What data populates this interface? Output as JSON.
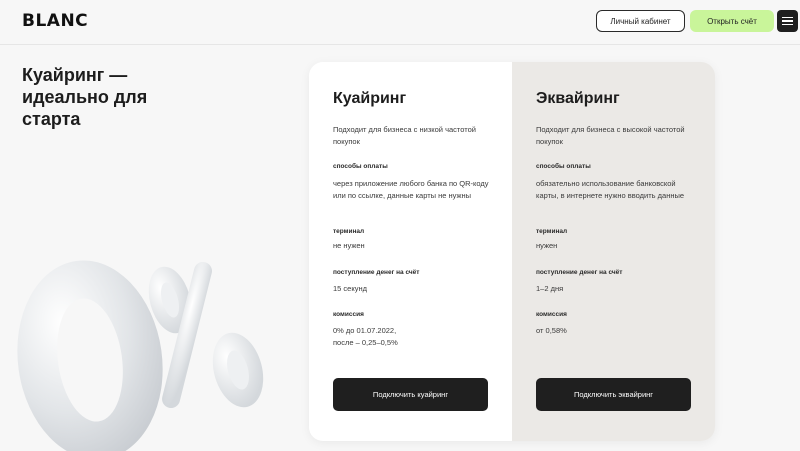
{
  "header": {
    "logo": "BLANC",
    "cabinet_label": "Личный кабинет",
    "open_account_label": "Открыть счёт",
    "menu_icon": "menu-icon"
  },
  "hero": {
    "title": "Куайринг — идеально для старта",
    "decoration_text": "0%"
  },
  "compare": {
    "left": {
      "title": "Куайринг",
      "description": "Подходит для бизнеса с низкой частотой покупок",
      "payment_label": "способы оплаты",
      "payment_value": "через приложение любого банка по QR-коду или по ссылке, данные карты не нужны",
      "terminal_label": "терминал",
      "terminal_value": "не нужен",
      "funds_label": "поступление денег на счёт",
      "funds_value": "15 секунд",
      "fee_label": "комиссия",
      "fee_value_1": "0% до 01.07.2022,",
      "fee_value_2": "после – 0,25–0,5%",
      "button": "Подключить куайринг"
    },
    "right": {
      "title": "Эквайринг",
      "description": "Подходит для бизнеса с высокой частотой покупок",
      "payment_label": "способы оплаты",
      "payment_value": "обязательно использование банковской карты, в интернете нужно вводить данные",
      "terminal_label": "терминал",
      "terminal_value": "нужен",
      "funds_label": "поступление денег на счёт",
      "funds_value": "1–2 дня",
      "fee_label": "комиссия",
      "fee_value": "от 0,58%",
      "button": "Подключить эквайринг"
    }
  },
  "colors": {
    "accent": "#c9f59a",
    "dark": "#1f1f1f",
    "right_panel": "#ebe9e6"
  }
}
